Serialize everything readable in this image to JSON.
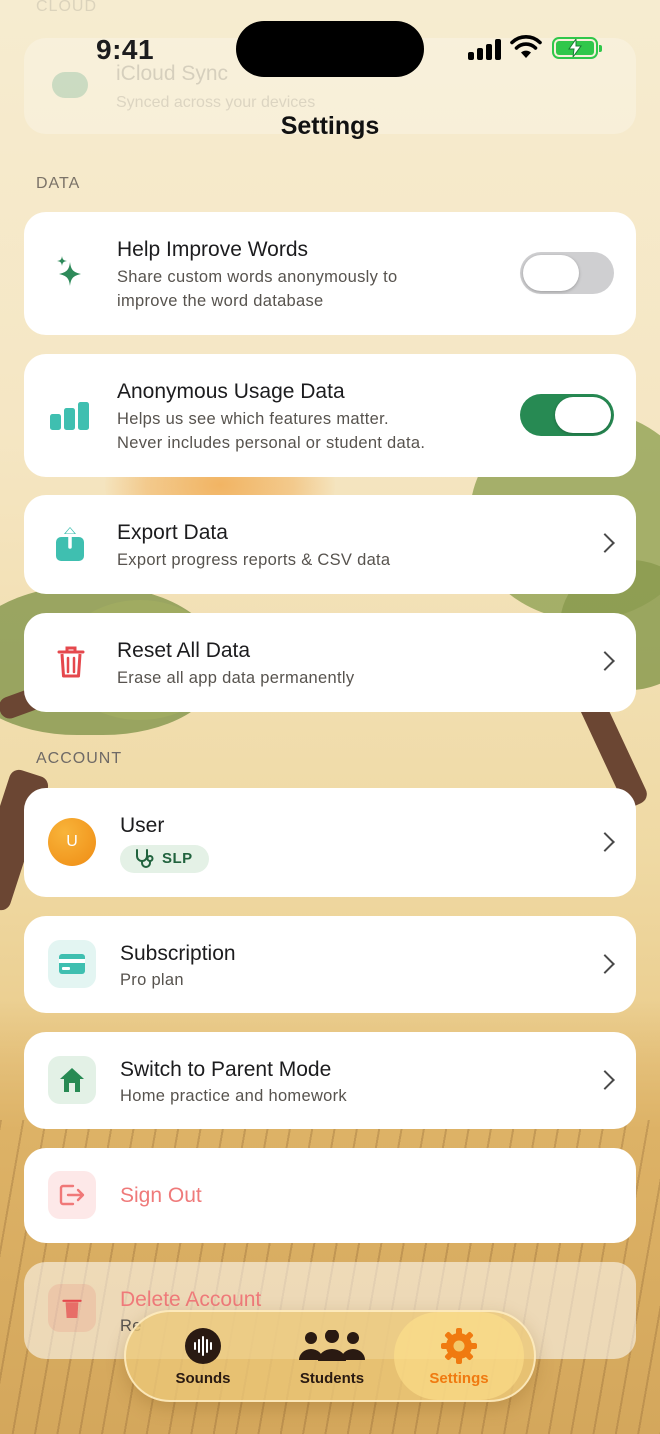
{
  "status_bar": {
    "time": "9:41"
  },
  "ghost_section": {
    "label": "CLOUD",
    "title": "iCloud Sync",
    "subtitle": "Synced across your devices"
  },
  "nav": {
    "title": "Settings"
  },
  "data_section": {
    "label": "DATA",
    "help_improve": {
      "title": "Help Improve Words",
      "subtitle_line1": "Share custom words anonymously to",
      "subtitle_line2": "improve the word database",
      "enabled": false
    },
    "usage_data": {
      "title": "Anonymous Usage Data",
      "subtitle_line1": "Helps us see which features matter.",
      "subtitle_line2": "Never includes personal or student data.",
      "enabled": true
    },
    "export": {
      "title": "Export Data",
      "subtitle": "Export progress reports & CSV data"
    },
    "reset": {
      "title": "Reset All Data",
      "subtitle": "Erase all app data permanently"
    }
  },
  "account_section": {
    "label": "ACCOUNT",
    "user": {
      "name": "User",
      "initial": "U",
      "role_badge": "SLP"
    },
    "subscription": {
      "title": "Subscription",
      "subtitle": "Pro plan"
    },
    "parent_mode": {
      "title": "Switch to Parent Mode",
      "subtitle": "Home practice and homework"
    },
    "sign_out": {
      "title": "Sign Out"
    },
    "delete_account": {
      "title": "Delete Account",
      "subtitle": "Re"
    }
  },
  "tab_bar": {
    "tabs": [
      {
        "label": "Sounds",
        "icon": "waveform-icon",
        "active": false
      },
      {
        "label": "Students",
        "icon": "people-icon",
        "active": false
      },
      {
        "label": "Settings",
        "icon": "gear-icon",
        "active": true
      }
    ]
  },
  "colors": {
    "accent_green": "#278a53",
    "teal": "#3fbfb0",
    "danger": "#e5484d",
    "active_tab": "#f07a10",
    "avatar_orange": "#ef8c14"
  }
}
